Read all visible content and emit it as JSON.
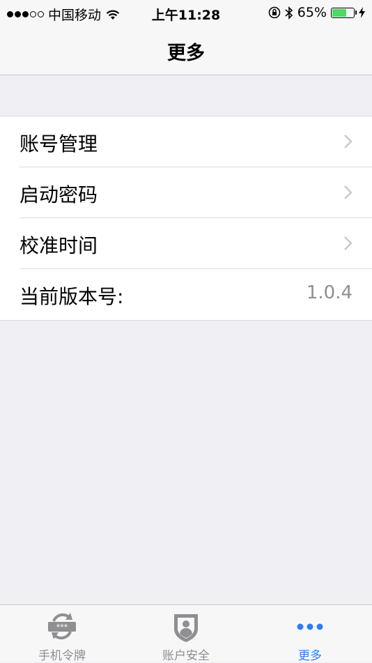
{
  "status_bar": {
    "carrier": "中国移动",
    "time": "上午11:28",
    "battery_percent": "65%",
    "battery_level": 0.65
  },
  "nav": {
    "title": "更多"
  },
  "menu": {
    "items": [
      {
        "label": "账号管理"
      },
      {
        "label": "启动密码"
      },
      {
        "label": "校准时间"
      }
    ],
    "version_label": "当前版本号:",
    "version_value": "1.0.4"
  },
  "tab_bar": {
    "tabs": [
      {
        "label": "手机令牌",
        "icon": "token-icon"
      },
      {
        "label": "账户安全",
        "icon": "shield-user-icon"
      },
      {
        "label": "更多",
        "icon": "more-dots-icon"
      }
    ],
    "active_index": 2,
    "active_color": "#2f7cf6"
  }
}
